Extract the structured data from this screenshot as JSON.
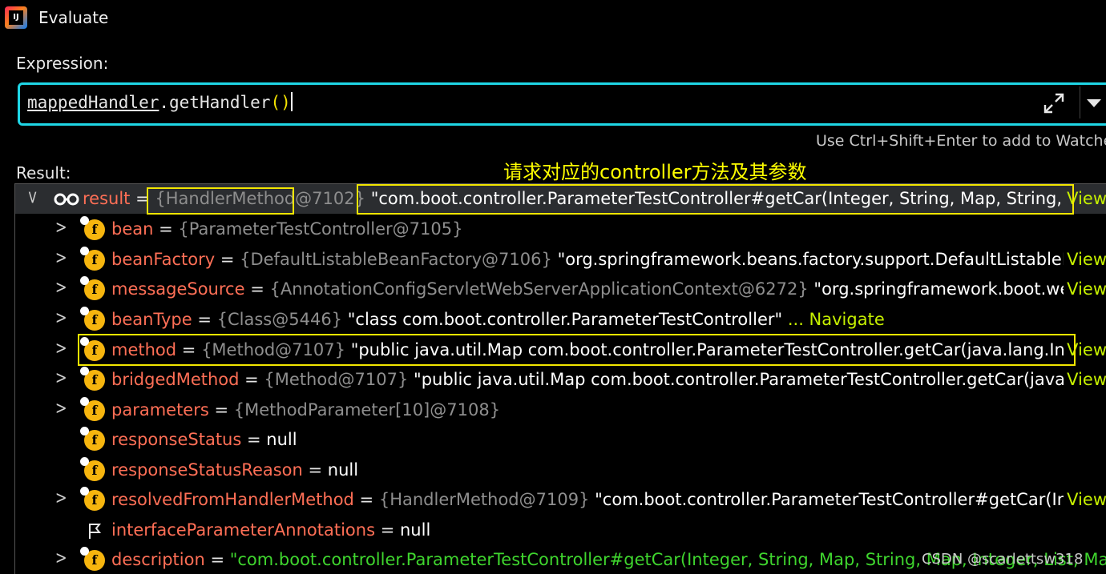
{
  "window": {
    "title": "Evaluate"
  },
  "expression": {
    "label": "Expression:",
    "part1": "mappedHandler",
    "part2": ".getHandler",
    "part3": "()"
  },
  "hint": "Use Ctrl+Shift+Enter to add to Watche",
  "annotation": "请求对应的controller方法及其参数",
  "result_label": "Result:",
  "rows": [
    {
      "name": "result",
      "ref": "{HandlerMethod@7102}",
      "value": "\"com.boot.controller.ParameterTestController#getCar(Integer, String, Map, String, Map,...",
      "link": "View"
    },
    {
      "name": "bean",
      "ref": "{ParameterTestController@7105}",
      "value": "",
      "link": ""
    },
    {
      "name": "beanFactory",
      "ref": "{DefaultListableBeanFactory@7106}",
      "value": "\"org.springframework.beans.factory.support.DefaultListableBeanF...",
      "link": "View"
    },
    {
      "name": "messageSource",
      "ref": "{AnnotationConfigServletWebServerApplicationContext@6272}",
      "value": "\"org.springframework.boot.web.ser...",
      "link": "View"
    },
    {
      "name": "beanType",
      "ref": "{Class@5446}",
      "value": "\"class com.boot.controller.ParameterTestController\"",
      "link": "... Navigate"
    },
    {
      "name": "method",
      "ref": "{Method@7107}",
      "value": "\"public java.util.Map com.boot.controller.ParameterTestController.getCar(java.lang.Intege...",
      "link": "View"
    },
    {
      "name": "bridgedMethod",
      "ref": "{Method@7107}",
      "value": "\"public java.util.Map com.boot.controller.ParameterTestController.getCar(java.lang...",
      "link": "View"
    },
    {
      "name": "parameters",
      "ref": "{MethodParameter[10]@7108}",
      "value": "",
      "link": ""
    },
    {
      "name": "responseStatus",
      "ref": "",
      "value": "null",
      "link": ""
    },
    {
      "name": "responseStatusReason",
      "ref": "",
      "value": "null",
      "link": ""
    },
    {
      "name": "resolvedFromHandlerMethod",
      "ref": "{HandlerMethod@7109}",
      "value": "\"com.boot.controller.ParameterTestController#getCar(Intege...",
      "link": "View"
    },
    {
      "name": "interfaceParameterAnnotations",
      "ref": "",
      "value": "null",
      "link": ""
    },
    {
      "name": "description",
      "ref": "",
      "value": "\"com.boot.controller.ParameterTestController#getCar(Integer, String, Map, String, Map, Integer, List, Map, Str",
      "link": ""
    }
  ],
  "watermark": "CSDN @scarlettsw318",
  "colors": {
    "accent": "#1fd6e6",
    "highlight": "#f2e600",
    "field_name": "#ff6f56",
    "link": "#c6f000"
  }
}
